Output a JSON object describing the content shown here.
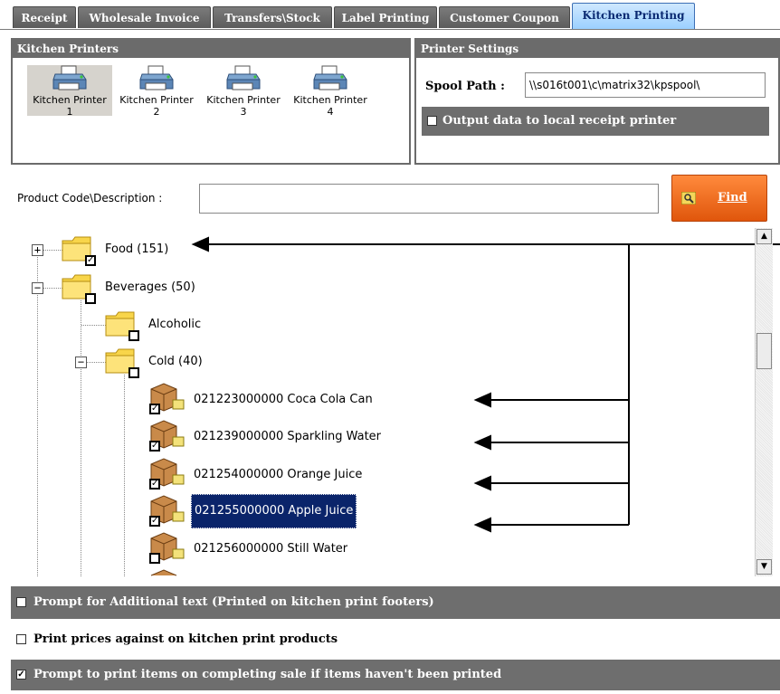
{
  "tabs": [
    {
      "label": "Receipt"
    },
    {
      "label": "Wholesale Invoice"
    },
    {
      "label": "Transfers\\Stock"
    },
    {
      "label": "Label Printing"
    },
    {
      "label": "Customer Coupon"
    },
    {
      "label": "Kitchen Printing"
    }
  ],
  "kitchen_printers": {
    "title": "Kitchen Printers",
    "items": [
      {
        "label": "Kitchen Printer",
        "num": "1",
        "selected": true
      },
      {
        "label": "Kitchen Printer",
        "num": "2",
        "selected": false
      },
      {
        "label": "Kitchen Printer",
        "num": "3",
        "selected": false
      },
      {
        "label": "Kitchen Printer",
        "num": "4",
        "selected": false
      }
    ]
  },
  "printer_settings": {
    "title": "Printer Settings",
    "spool_label": "Spool Path :",
    "spool_value": "\\\\s016t001\\c\\matrix32\\kpspool\\",
    "output_local_label": "Output data to local receipt printer",
    "output_local_checked": false
  },
  "search": {
    "label": "Product Code\\Description :",
    "value": "",
    "find_label": "Find",
    "find_icon": "magnifier-icon"
  },
  "tree": {
    "food": {
      "label": "Food (151)",
      "checked": true,
      "expanded": false
    },
    "beverages": {
      "label": "Beverages (50)",
      "checked": false,
      "expanded": true
    },
    "alcoholic": {
      "label": "Alcoholic",
      "checked": false
    },
    "cold": {
      "label": "Cold (40)",
      "checked": false,
      "expanded": true
    },
    "products": [
      {
        "label": "021223000000 Coca Cola Can",
        "checked": true,
        "selected": false
      },
      {
        "label": "021239000000 Sparkling Water",
        "checked": true,
        "selected": false
      },
      {
        "label": "021254000000 Orange Juice",
        "checked": true,
        "selected": false
      },
      {
        "label": "021255000000 Apple Juice",
        "checked": true,
        "selected": true
      },
      {
        "label": "021256000000 Still Water",
        "checked": false,
        "selected": false
      }
    ]
  },
  "options": {
    "prompt_additional": {
      "label": "Prompt for Additional text (Printed on kitchen print footers)",
      "checked": false
    },
    "print_prices": {
      "label": "Print prices against on kitchen print products",
      "checked": false
    },
    "prompt_print": {
      "label": "Prompt to print items on completing sale if items haven't been printed",
      "checked": true
    }
  },
  "colors": {
    "accent_tab": "#9bd0ff",
    "find_button": "#f06a1c",
    "selection": "#0a246a",
    "panel_header": "#6b6b6b"
  }
}
